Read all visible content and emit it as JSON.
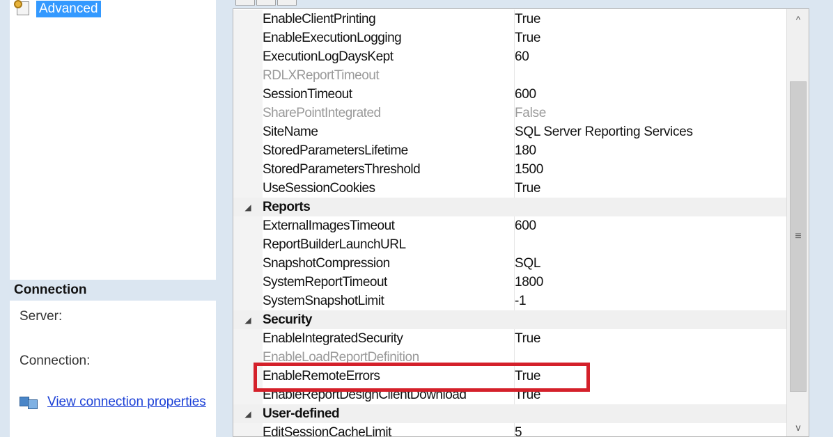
{
  "left_pane": {
    "selected_page": "Advanced",
    "connection_header": "Connection",
    "server_label": "Server:",
    "connection_label": "Connection:",
    "view_connection_link": "View connection properties"
  },
  "grid": {
    "rows": [
      {
        "kind": "prop",
        "name": "EnableClientPrinting",
        "value": "True"
      },
      {
        "kind": "prop",
        "name": "EnableExecutionLogging",
        "value": "True"
      },
      {
        "kind": "prop",
        "name": "ExecutionLogDaysKept",
        "value": "60"
      },
      {
        "kind": "disabled",
        "name": "RDLXReportTimeout",
        "value": ""
      },
      {
        "kind": "prop",
        "name": "SessionTimeout",
        "value": "600"
      },
      {
        "kind": "disabled",
        "name": "SharePointIntegrated",
        "value": "False"
      },
      {
        "kind": "prop",
        "name": "SiteName",
        "value": "SQL Server Reporting Services"
      },
      {
        "kind": "prop",
        "name": "StoredParametersLifetime",
        "value": "180"
      },
      {
        "kind": "prop",
        "name": "StoredParametersThreshold",
        "value": "1500"
      },
      {
        "kind": "prop",
        "name": "UseSessionCookies",
        "value": "True"
      },
      {
        "kind": "cat",
        "name": "Reports",
        "value": ""
      },
      {
        "kind": "prop",
        "name": "ExternalImagesTimeout",
        "value": "600"
      },
      {
        "kind": "prop",
        "name": "ReportBuilderLaunchURL",
        "value": ""
      },
      {
        "kind": "prop",
        "name": "SnapshotCompression",
        "value": "SQL"
      },
      {
        "kind": "prop",
        "name": "SystemReportTimeout",
        "value": "1800"
      },
      {
        "kind": "prop",
        "name": "SystemSnapshotLimit",
        "value": "-1"
      },
      {
        "kind": "cat",
        "name": "Security",
        "value": ""
      },
      {
        "kind": "prop",
        "name": "EnableIntegratedSecurity",
        "value": "True"
      },
      {
        "kind": "disabled",
        "name": "EnableLoadReportDefinition",
        "value": ""
      },
      {
        "kind": "prop",
        "name": "EnableRemoteErrors",
        "value": "True"
      },
      {
        "kind": "prop",
        "name": "EnableReportDesignClientDownload",
        "value": "True"
      },
      {
        "kind": "cat",
        "name": "User-defined",
        "value": ""
      },
      {
        "kind": "prop",
        "name": "EditSessionCacheLimit",
        "value": "5"
      }
    ],
    "collapse_glyph": "◢",
    "scroll_up_glyph": "^",
    "scroll_down_glyph": "v",
    "scroll_grip_glyph": "≡"
  },
  "colors": {
    "highlight": "#d4202a",
    "selection": "#3399ff",
    "link": "#1a3fd6"
  }
}
